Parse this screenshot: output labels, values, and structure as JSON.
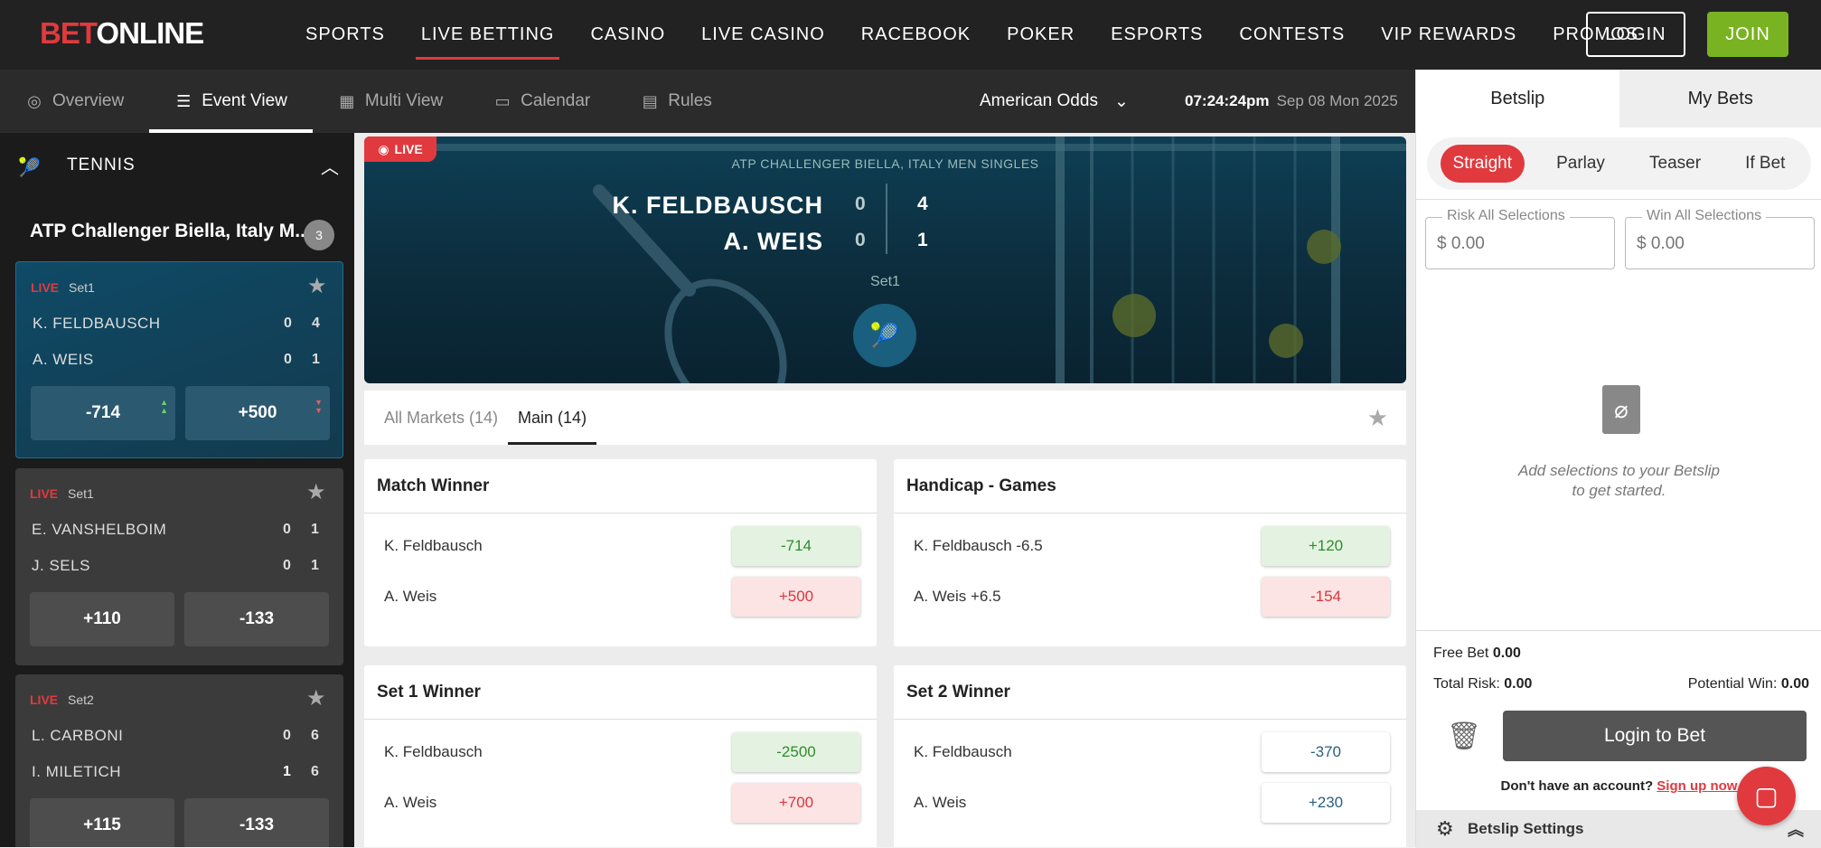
{
  "header": {
    "logo_bet": "BET",
    "logo_online": "ONLINE",
    "nav": [
      "SPORTS",
      "LIVE BETTING",
      "CASINO",
      "LIVE CASINO",
      "RACEBOOK",
      "POKER",
      "ESPORTS",
      "CONTESTS",
      "VIP REWARDS",
      "PROMOS"
    ],
    "active_nav": "LIVE BETTING",
    "login": "LOGIN",
    "join": "JOIN"
  },
  "subnav": {
    "items": [
      "Overview",
      "Event View",
      "Multi View",
      "Calendar",
      "Rules"
    ],
    "odds_format": "American Odds",
    "time": "07:24:24pm",
    "date": "Sep 08 Mon 2025"
  },
  "sidebar": {
    "sport": "TENNIS",
    "league": "ATP Challenger Biella, Italy M...",
    "league_count": "3",
    "events": [
      {
        "live": "LIVE",
        "set": "Set1",
        "p1": "K. FELDBAUSCH",
        "p1_games": "0",
        "p1_sets": "4",
        "p2": "A. WEIS",
        "p2_games": "0",
        "p2_sets": "1",
        "odd1": "-714",
        "odd2": "+500"
      },
      {
        "live": "LIVE",
        "set": "Set1",
        "p1": "E. VANSHELBOIM",
        "p1_games": "0",
        "p1_sets": "1",
        "p2": "J. SELS",
        "p2_games": "0",
        "p2_sets": "1",
        "odd1": "+110",
        "odd2": "-133"
      },
      {
        "live": "LIVE",
        "set": "Set2",
        "p1": "L. CARBONI",
        "p1_games": "0",
        "p1_sets": "6",
        "p2": "I. MILETICH",
        "p2_games": "1",
        "p2_sets": "6",
        "odd1": "+115",
        "odd2": "-133"
      }
    ]
  },
  "hero": {
    "live": "LIVE",
    "league": "ATP CHALLENGER BIELLA, ITALY MEN SINGLES",
    "p1": "K. FELDBAUSCH",
    "p1_games": "0",
    "p1_sets": "4",
    "p2": "A. WEIS",
    "p2_games": "0",
    "p2_sets": "1",
    "set": "Set1"
  },
  "market_tabs": [
    "All Markets (14)",
    "Main (14)"
  ],
  "markets": [
    {
      "title": "Match Winner",
      "rows": [
        {
          "name": "K. Feldbausch",
          "odd": "-714"
        },
        {
          "name": "A. Weis",
          "odd": "+500"
        }
      ]
    },
    {
      "title": "Handicap - Games",
      "rows": [
        {
          "name": "K. Feldbausch -6.5",
          "odd": "+120"
        },
        {
          "name": "A. Weis +6.5",
          "odd": "-154"
        }
      ]
    },
    {
      "title": "Set 1 Winner",
      "rows": [
        {
          "name": "K. Feldbausch",
          "odd": "-2500"
        },
        {
          "name": "A. Weis",
          "odd": "+700"
        }
      ]
    },
    {
      "title": "Set 2 Winner",
      "rows": [
        {
          "name": "K. Feldbausch",
          "odd": "-370"
        },
        {
          "name": "A. Weis",
          "odd": "+230"
        }
      ]
    }
  ],
  "betslip": {
    "tabs": [
      "Betslip",
      "My Bets"
    ],
    "types": [
      "Straight",
      "Parlay",
      "Teaser",
      "If Bet"
    ],
    "risk_label": "Risk All Selections",
    "risk_placeholder": "$ 0.00",
    "win_label": "Win All Selections",
    "win_placeholder": "$ 0.00",
    "empty_line1": "Add selections to your Betslip",
    "empty_line2": "to get started.",
    "free_bet_label": "Free Bet",
    "free_bet_value": "0.00",
    "total_risk_label": "Total Risk:",
    "total_risk_value": "0.00",
    "potential_win_label": "Potential Win:",
    "potential_win_value": "0.00",
    "login_button": "Login to Bet",
    "signup_text": "Don't have an account?",
    "signup_link": "Sign up now",
    "settings": "Betslip Settings"
  },
  "colors": {
    "brand_red": "#e03a3e",
    "join_green": "#7ab322"
  }
}
